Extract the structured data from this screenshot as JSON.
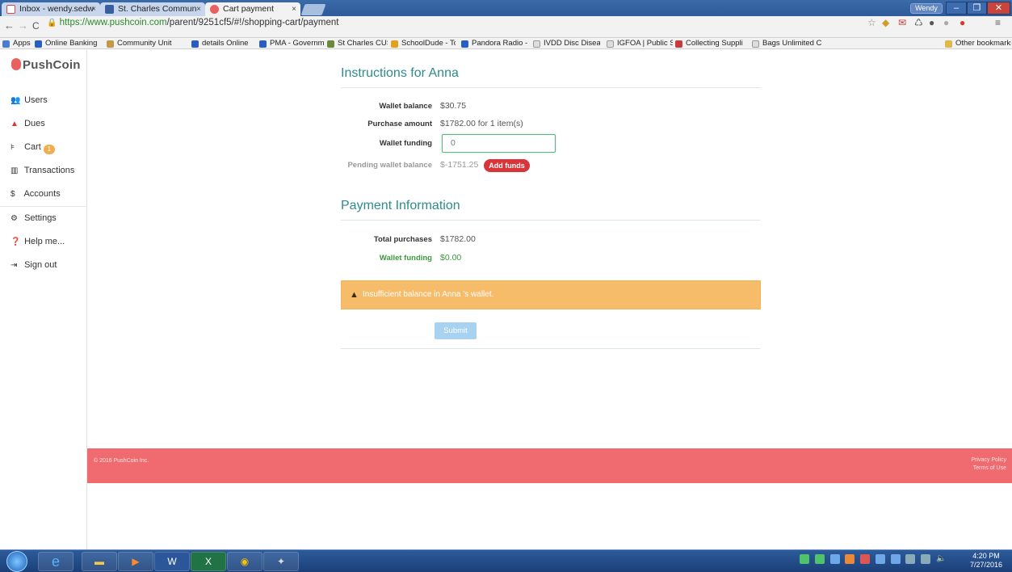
{
  "browser": {
    "tabs": [
      {
        "label": "Inbox - wendy.sedw",
        "active": false
      },
      {
        "label": "St. Charles Commun",
        "active": false
      },
      {
        "label": "Cart payment",
        "active": true
      }
    ],
    "user": "Wendy",
    "url": {
      "host": "https://www.pushcoin.com",
      "path": "/parent/9251cf5/#!/shopping-cart/payment"
    },
    "bookmarks": [
      "Apps",
      "Online Banking fo",
      "Community Unit",
      "details Online",
      "PMA - Governme",
      "St Charles CUSD",
      "SchoolDude - To",
      "Pandora Radio -",
      "IVDD Disc Diseas",
      "IGFOA | Public Se",
      "Collecting Suppli",
      "Bags Unlimited C",
      "Other bookmarks"
    ]
  },
  "app": {
    "logo": "PushCoin",
    "sidebar": [
      {
        "label": "Users",
        "icon": "users-icon"
      },
      {
        "label": "Dues",
        "icon": "bell-icon"
      },
      {
        "label": "Cart",
        "icon": "cart-icon",
        "badge": "1"
      },
      {
        "label": "Transactions",
        "icon": "bar-chart-icon"
      },
      {
        "label": "Accounts",
        "icon": "dollar-icon"
      },
      {
        "label": "Settings",
        "icon": "gears-icon"
      },
      {
        "label": "Help me...",
        "icon": "question-icon"
      },
      {
        "label": "Sign out",
        "icon": "sign-out-icon"
      }
    ],
    "instructions": {
      "title": "Instructions for Anna",
      "wallet_balance_label": "Wallet balance",
      "wallet_balance": "$30.75",
      "purchase_amount_label": "Purchase amount",
      "purchase_amount": "$1782.00 for 1 item(s)",
      "wallet_funding_label": "Wallet funding",
      "wallet_funding_value": "0",
      "pending_label": "Pending wallet balance",
      "pending_value": "$-1751.25",
      "add_funds": "Add funds"
    },
    "payment": {
      "title": "Payment Information",
      "total_label": "Total purchases",
      "total_value": "$1782.00",
      "funding_label": "Wallet funding",
      "funding_value": "$0.00"
    },
    "alert": "Insufficient balance in Anna 's wallet.",
    "submit": "Submit",
    "footer": {
      "copyright": "© 2016 PushCoin Inc.",
      "privacy": "Privacy Policy",
      "terms": "Terms of Use"
    }
  },
  "taskbar": {
    "time": "4:20 PM",
    "date": "7/27/2016"
  },
  "colors": {
    "accent": "#2e8b8b",
    "danger": "#d9343a",
    "warning": "#f7bc6a",
    "footer": "#ef6b6f"
  }
}
